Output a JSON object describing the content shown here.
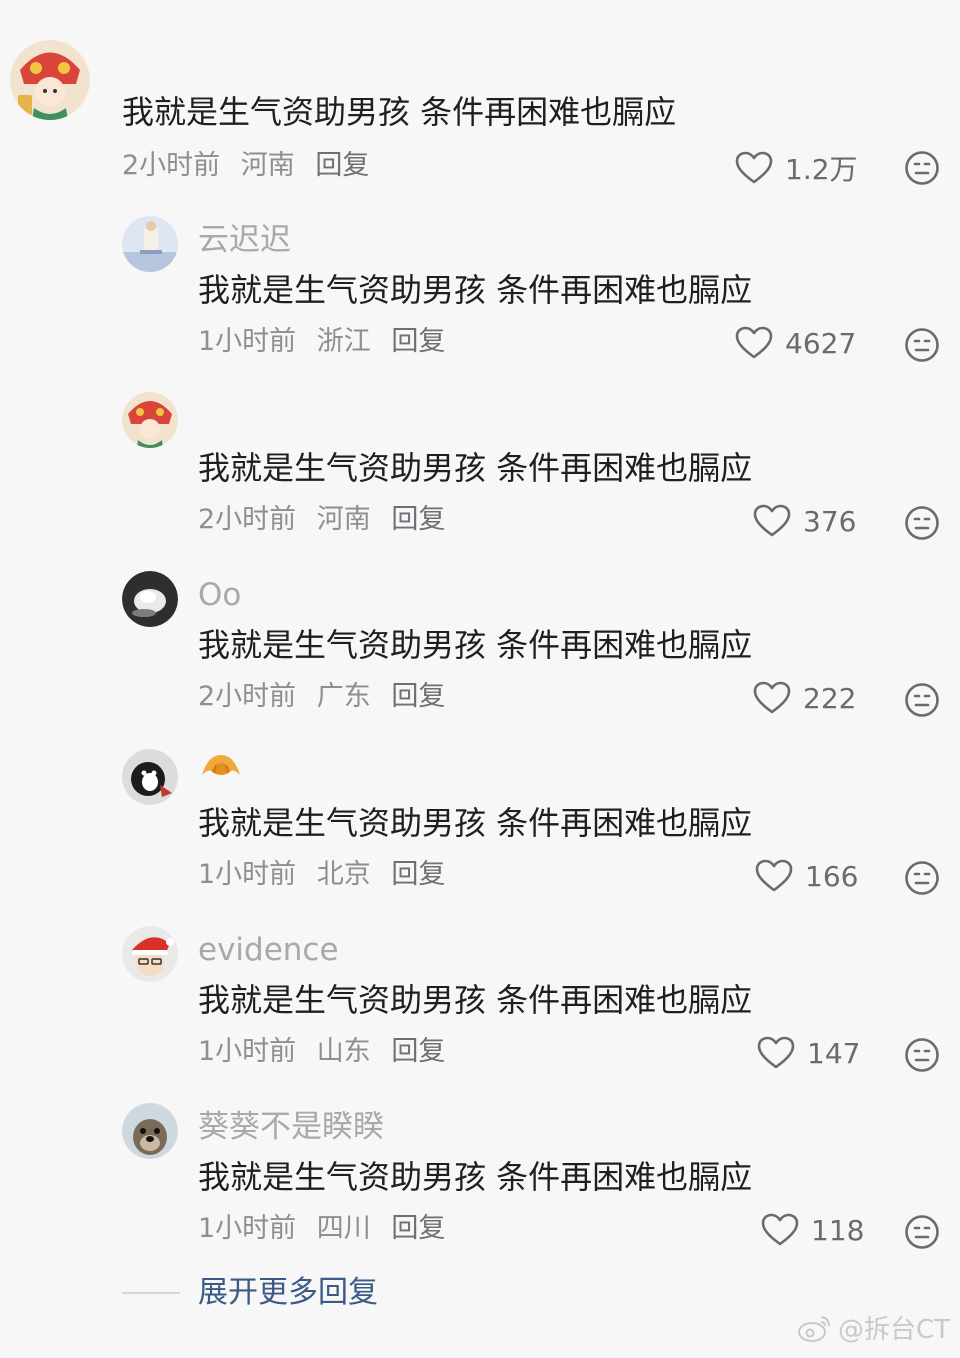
{
  "main_comment": {
    "text": "我就是生气资助男孩 条件再困难也膈应",
    "time": "2小时前",
    "location": "河南",
    "reply_label": "回复",
    "likes": "1.2万"
  },
  "replies": [
    {
      "username": "云迟迟",
      "text": "我就是生气资助男孩 条件再困难也膈应",
      "time": "1小时前",
      "location": "浙江",
      "reply_label": "回复",
      "likes": "4627"
    },
    {
      "username": "",
      "text": "我就是生气资助男孩 条件再困难也膈应",
      "time": "2小时前",
      "location": "河南",
      "reply_label": "回复",
      "likes": "376"
    },
    {
      "username": "Oo",
      "text": "我就是生气资助男孩 条件再困难也膈应",
      "time": "2小时前",
      "location": "广东",
      "reply_label": "回复",
      "likes": "222"
    },
    {
      "username": "",
      "text": "我就是生气资助男孩 条件再困难也膈应",
      "time": "1小时前",
      "location": "北京",
      "reply_label": "回复",
      "likes": "166"
    },
    {
      "username": "evidence",
      "text": "我就是生气资助男孩 条件再困难也膈应",
      "time": "1小时前",
      "location": "山东",
      "reply_label": "回复",
      "likes": "147"
    },
    {
      "username": "葵葵不是睽睽",
      "text": "我就是生气资助男孩 条件再困难也膈应",
      "time": "1小时前",
      "location": "四川",
      "reply_label": "回复",
      "likes": "118"
    }
  ],
  "expand_more_label": "展开更多回复",
  "watermark": "@拆台CT",
  "icons": {
    "like": "heart-outline-icon",
    "dislike": "neutral-face-icon",
    "croissant": "croissant-emoji-icon"
  },
  "colors": {
    "background": "#f7f7f7",
    "username": "#a8a8ad",
    "meta": "#8e8e93",
    "expand_link": "#3b5a85"
  }
}
